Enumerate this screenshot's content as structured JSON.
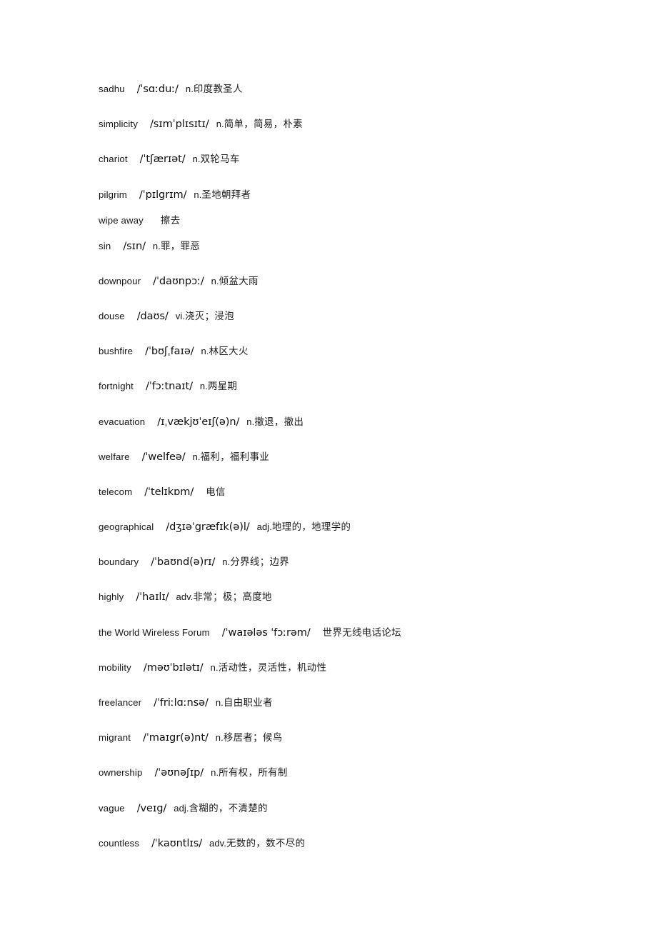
{
  "page": {
    "background_color": "#ffffff",
    "text_color": "#151515",
    "kind": "vocabulary-glossary-page"
  },
  "entries": [
    {
      "word": "sadhu",
      "ipa": "/ˈsɑːduː/",
      "pos": "n.",
      "gloss": "印度教圣人",
      "spacing": "normal"
    },
    {
      "word": "simplicity",
      "ipa": "/sɪmˈplɪsɪtɪ/",
      "pos": "n.",
      "gloss": "简单，简易，朴素",
      "spacing": "normal"
    },
    {
      "word": "chariot",
      "ipa": "/ˈtʃærɪət/",
      "pos": "n.",
      "gloss": "双轮马车",
      "spacing": "normal"
    },
    {
      "word": "pilgrim",
      "ipa": "/ˈpɪlgrɪm/",
      "pos": "n.",
      "gloss": "圣地朝拜者",
      "spacing": "tight"
    },
    {
      "word": "wipe away",
      "ipa": "",
      "pos": "",
      "gloss": "擦去",
      "spacing": "tight"
    },
    {
      "word": "sin",
      "ipa": "/sɪn/",
      "pos": "n.",
      "gloss": "罪，罪恶",
      "spacing": "tight"
    },
    {
      "word": "downpour",
      "ipa": "/ˈdaʊnpɔː/",
      "pos": "n.",
      "gloss": "倾盆大雨",
      "spacing": "normal"
    },
    {
      "word": "douse",
      "ipa": "/daʊs/",
      "pos": "vi.",
      "gloss": "浇灭；浸泡",
      "spacing": "normal"
    },
    {
      "word": "bushfire",
      "ipa": "/ˈbʊʃˌfaɪə/",
      "pos": "n.",
      "gloss": "林区大火",
      "spacing": "normal"
    },
    {
      "word": "fortnight",
      "ipa": "/ˈfɔːtnaɪt/",
      "pos": "n.",
      "gloss": "两星期",
      "spacing": "normal"
    },
    {
      "word": "evacuation",
      "ipa": "/ɪˌvækjʊˈeɪʃ(ə)n/",
      "pos": "n.",
      "gloss": "撤退，撤出",
      "spacing": "normal"
    },
    {
      "word": "welfare",
      "ipa": "/ˈwelfeə/",
      "pos": "n.",
      "gloss": "福利，福利事业",
      "spacing": "normal"
    },
    {
      "word": "telecom",
      "ipa": "/ˈtelɪkɒm/",
      "pos": "",
      "gloss": "电信",
      "spacing": "normal"
    },
    {
      "word": "geographical",
      "ipa": "/dʒɪəˈgræfɪk(ə)l/",
      "pos": "adj.",
      "gloss": "地理的，地理学的",
      "spacing": "normal"
    },
    {
      "word": "boundary",
      "ipa": "/ˈbaʊnd(ə)rɪ/",
      "pos": "n.",
      "gloss": "分界线；边界",
      "spacing": "normal"
    },
    {
      "word": "highly",
      "ipa": "/ˈhaɪlɪ/",
      "pos": "adv.",
      "gloss": "非常；极；高度地",
      "spacing": "normal"
    },
    {
      "word": "the World Wireless Forum",
      "ipa": "/ˈwaɪələs ˈfɔːrəm/",
      "pos": "",
      "gloss": "世界无线电话论坛",
      "spacing": "normal"
    },
    {
      "word": "mobility",
      "ipa": "/məʊˈbɪlətɪ/",
      "pos": "n.",
      "gloss": "活动性，灵活性，机动性",
      "spacing": "normal"
    },
    {
      "word": "freelancer",
      "ipa": "/ˈfriːlɑːnsə/",
      "pos": "n.",
      "gloss": "自由职业者",
      "spacing": "normal"
    },
    {
      "word": "migrant",
      "ipa": "/ˈmaɪgr(ə)nt/",
      "pos": "n.",
      "gloss": "移居者；候鸟",
      "spacing": "normal"
    },
    {
      "word": "ownership",
      "ipa": "/ˈəʊnəʃɪp/",
      "pos": "n.",
      "gloss": "所有权，所有制",
      "spacing": "normal"
    },
    {
      "word": "vague",
      "ipa": "/veɪg/",
      "pos": "adj.",
      "gloss": "含糊的，不清楚的",
      "spacing": "normal"
    },
    {
      "word": "countless",
      "ipa": "/ˈkaʊntlɪs/",
      "pos": "adv.",
      "gloss": "无数的，数不尽的",
      "spacing": "normal"
    }
  ]
}
